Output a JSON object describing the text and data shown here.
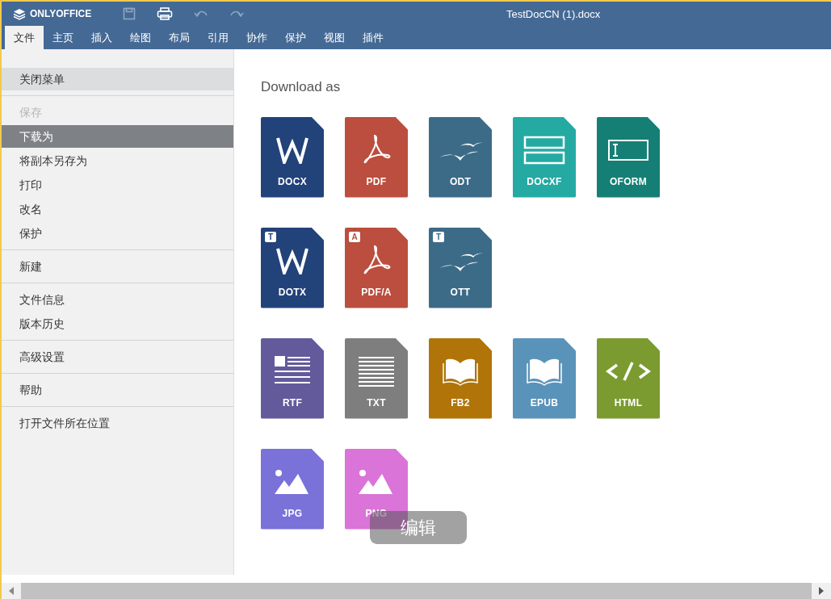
{
  "app": {
    "logo": "ONLYOFFICE",
    "title": "TestDocCN (1).docx"
  },
  "toolbar": [
    {
      "kind": "save",
      "disabled": true
    },
    {
      "kind": "print",
      "disabled": false
    },
    {
      "kind": "undo",
      "disabled": true
    },
    {
      "kind": "redo",
      "disabled": true
    }
  ],
  "tabs": [
    {
      "label": "文件",
      "selected": true
    },
    {
      "label": "主页",
      "selected": false
    },
    {
      "label": "插入",
      "selected": false
    },
    {
      "label": "绘图",
      "selected": false
    },
    {
      "label": "布局",
      "selected": false
    },
    {
      "label": "引用",
      "selected": false
    },
    {
      "label": "协作",
      "selected": false
    },
    {
      "label": "保护",
      "selected": false
    },
    {
      "label": "视图",
      "selected": false
    },
    {
      "label": "插件",
      "selected": false
    }
  ],
  "menu": [
    [
      {
        "label": "关闭菜单",
        "selected": false,
        "disabled": false,
        "kind": "close"
      }
    ],
    [
      {
        "label": "保存",
        "selected": false,
        "disabled": true,
        "kind": "item"
      },
      {
        "label": "下载为",
        "selected": true,
        "disabled": false,
        "kind": "item"
      },
      {
        "label": "将副本另存为",
        "selected": false,
        "disabled": false,
        "kind": "item"
      },
      {
        "label": "打印",
        "selected": false,
        "disabled": false,
        "kind": "item"
      },
      {
        "label": "改名",
        "selected": false,
        "disabled": false,
        "kind": "item"
      },
      {
        "label": "保护",
        "selected": false,
        "disabled": false,
        "kind": "item"
      }
    ],
    [
      {
        "label": "新建",
        "selected": false,
        "disabled": false,
        "kind": "item"
      }
    ],
    [
      {
        "label": "文件信息",
        "selected": false,
        "disabled": false,
        "kind": "item"
      },
      {
        "label": "版本历史",
        "selected": false,
        "disabled": false,
        "kind": "item"
      }
    ],
    [
      {
        "label": "高级设置",
        "selected": false,
        "disabled": false,
        "kind": "item"
      }
    ],
    [
      {
        "label": "帮助",
        "selected": false,
        "disabled": false,
        "kind": "item"
      }
    ],
    [
      {
        "label": "打开文件所在位置",
        "selected": false,
        "disabled": false,
        "kind": "item"
      }
    ]
  ],
  "download": {
    "heading": "Download as",
    "rows": [
      [
        {
          "label": "DOCX",
          "kind": "word",
          "color": "#22427a"
        },
        {
          "label": "PDF",
          "kind": "pdf",
          "color": "#bb4e3e"
        },
        {
          "label": "ODT",
          "kind": "odt",
          "color": "#3c6b88"
        },
        {
          "label": "DOCXF",
          "kind": "docxf",
          "color": "#24aaa3"
        },
        {
          "label": "OFORM",
          "kind": "oform",
          "color": "#157f75"
        }
      ],
      [
        {
          "label": "DOTX",
          "kind": "word",
          "color": "#22427a",
          "badge": "T"
        },
        {
          "label": "PDF/A",
          "kind": "pdf",
          "color": "#bb4e3e",
          "badge": "A"
        },
        {
          "label": "OTT",
          "kind": "odt",
          "color": "#3c6b88",
          "badge": "T"
        }
      ],
      [
        {
          "label": "RTF",
          "kind": "rtf",
          "color": "#635a9c"
        },
        {
          "label": "TXT",
          "kind": "txt",
          "color": "#7e7e7e"
        },
        {
          "label": "FB2",
          "kind": "book",
          "color": "#b07409"
        },
        {
          "label": "EPUB",
          "kind": "book",
          "color": "#5993b9"
        },
        {
          "label": "HTML",
          "kind": "html",
          "color": "#7b9b31"
        }
      ],
      [
        {
          "label": "JPG",
          "kind": "image",
          "color": "#7a72d8"
        },
        {
          "label": "PNG",
          "kind": "image",
          "color": "#da74d8"
        }
      ]
    ]
  },
  "toast": "编辑"
}
